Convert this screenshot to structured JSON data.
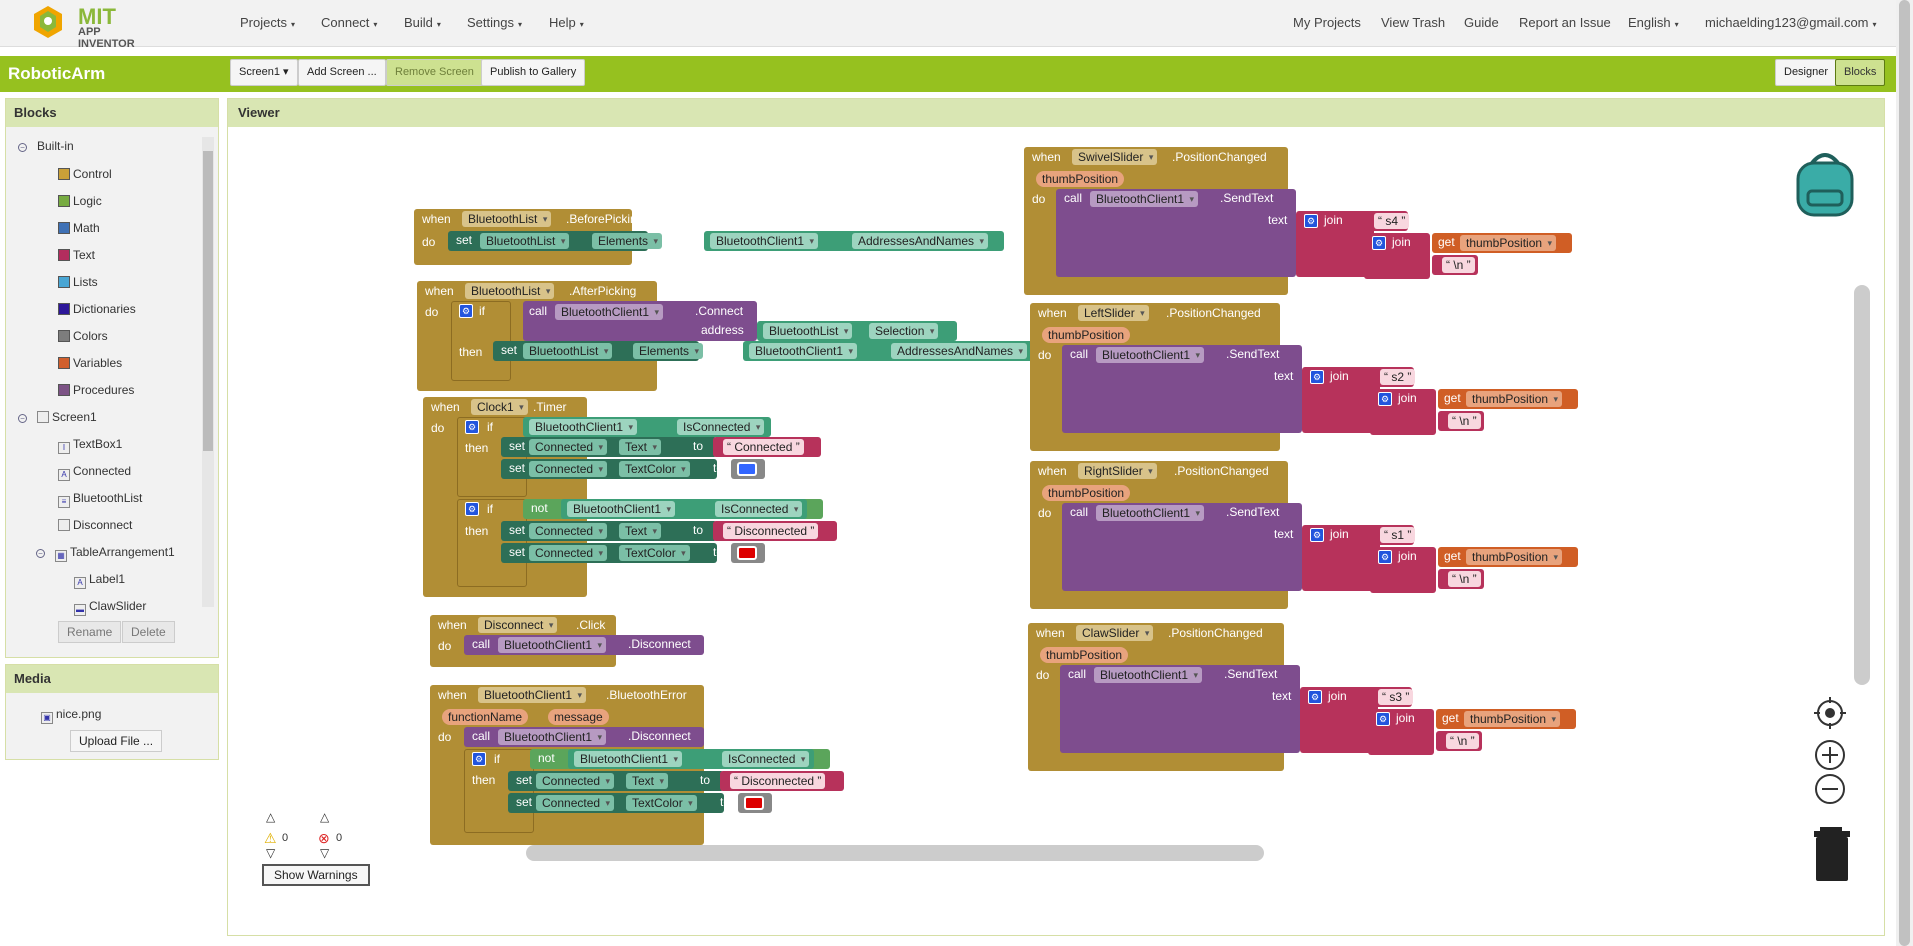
{
  "brand": {
    "mit": "MIT",
    "app": "APP INVENTOR"
  },
  "nav": {
    "menus": [
      "Projects",
      "Connect",
      "Build",
      "Settings",
      "Help"
    ],
    "right_links": [
      "My Projects",
      "View Trash",
      "Guide",
      "Report an Issue"
    ],
    "language": "English",
    "account": "michaelding123@gmail.com"
  },
  "appbar": {
    "project": "RoboticArm",
    "screen": "Screen1",
    "add_screen": "Add Screen ...",
    "remove_screen": "Remove Screen",
    "publish": "Publish to Gallery",
    "designer": "Designer",
    "blocks": "Blocks"
  },
  "blocks_panel": {
    "title": "Blocks",
    "builtin": "Built-in",
    "builtin_items": [
      {
        "label": "Control",
        "color": "#c9a038"
      },
      {
        "label": "Logic",
        "color": "#77ab41"
      },
      {
        "label": "Math",
        "color": "#3f71b5"
      },
      {
        "label": "Text",
        "color": "#b32d5e"
      },
      {
        "label": "Lists",
        "color": "#49a6d4"
      },
      {
        "label": "Dictionaries",
        "color": "#2d1799"
      },
      {
        "label": "Colors",
        "color": "#7d7d7d"
      },
      {
        "label": "Variables",
        "color": "#d05f2d"
      },
      {
        "label": "Procedures",
        "color": "#7c5385"
      }
    ],
    "screen": "Screen1",
    "components": [
      "TextBox1",
      "Connected",
      "BluetoothList",
      "Disconnect",
      "TableArrangement1",
      "Label1",
      "ClawSlider"
    ],
    "rename": "Rename",
    "delete": "Delete"
  },
  "media_panel": {
    "title": "Media",
    "file": "nice.png",
    "upload": "Upload File ..."
  },
  "viewer": {
    "title": "Viewer",
    "warnings_count": "0",
    "errors_count": "0",
    "show_warnings": "Show Warnings"
  },
  "blocks": {
    "kw_when": "when",
    "kw_do": "do",
    "kw_set": "set",
    "kw_to": "to",
    "kw_call": "call",
    "kw_if": "if",
    "kw_then": "then",
    "kw_not": "not",
    "kw_get": "get",
    "kw_join": "join",
    "kw_text": "text",
    "kw_address": "address",
    "bt_list": "BluetoothList",
    "bt_client": "BluetoothClient1",
    "clock": "Clock1",
    "connected": "Connected",
    "disconnect_btn": "Disconnect",
    "ev_before": ".BeforePicking",
    "ev_after": ".AfterPicking",
    "ev_timer": ".Timer",
    "ev_click": ".Click",
    "ev_bterror": ".BluetoothError",
    "ev_poschanged": ".PositionChanged",
    "m_connect": ".Connect",
    "m_disconnect": ".Disconnect",
    "m_sendtext": ".SendText",
    "p_elements": "Elements",
    "p_addresses": "AddressesAndNames",
    "p_selection": "Selection",
    "p_isconnected": "IsConnected",
    "p_text": "Text",
    "p_textcolor": "TextColor",
    "s_connected": "Connected",
    "s_disconnected": "Disconnected",
    "param_thumb": "thumbPosition",
    "param_function": "functionName",
    "param_message": "message",
    "newline": "\\n",
    "sliders": [
      {
        "name": "SwivelSlider",
        "code": "s4"
      },
      {
        "name": "LeftSlider",
        "code": "s2"
      },
      {
        "name": "RightSlider",
        "code": "s1"
      },
      {
        "name": "ClawSlider",
        "code": "s3"
      }
    ],
    "color_blue": "#3366ff",
    "color_red": "#dd0000"
  }
}
